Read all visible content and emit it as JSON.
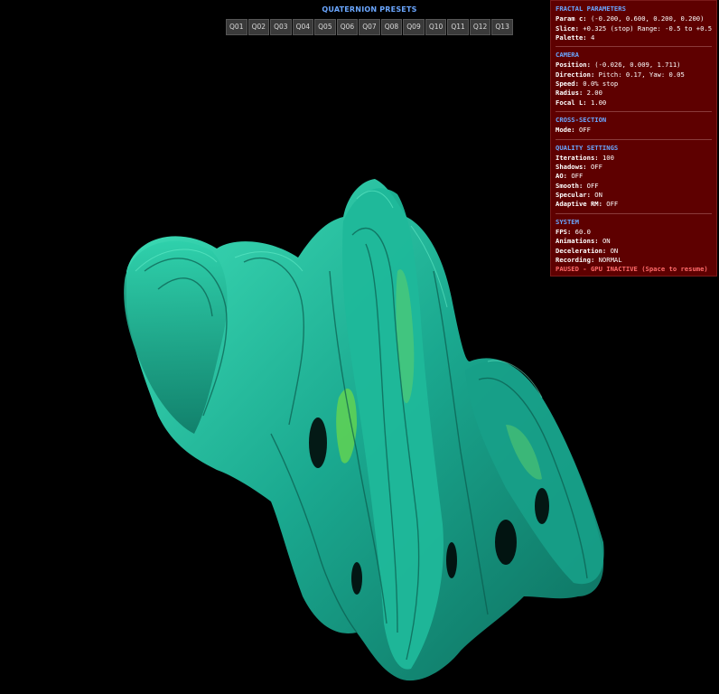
{
  "presets": {
    "title": "QUATERNION PRESETS",
    "buttons": [
      "Q01",
      "Q02",
      "Q03",
      "Q04",
      "Q05",
      "Q06",
      "Q07",
      "Q08",
      "Q09",
      "Q10",
      "Q11",
      "Q12",
      "Q13"
    ]
  },
  "panel": {
    "fractal": {
      "title": "FRACTAL PARAMETERS",
      "param_c_label": "Param c:",
      "param_c_value": "(-0.200, 0.600, 0.200, 0.200)",
      "slice_label": "Slice:",
      "slice_value": "+0.325 (stop) Range: -0.5 to +0.5",
      "palette_label": "Palette:",
      "palette_value": "4"
    },
    "camera": {
      "title": "CAMERA",
      "position_label": "Position:",
      "position_value": "(-0.026, 0.009, 1.711)",
      "direction_label": "Direction:",
      "direction_value": "Pitch: 0.17, Yaw: 0.05",
      "speed_label": "Speed:",
      "speed_value": "0.0% stop",
      "radius_label": "Radius:",
      "radius_value": "2.00",
      "focal_label": "Focal L:",
      "focal_value": "1.00"
    },
    "cross_section": {
      "title": "CROSS-SECTION",
      "mode_label": "Mode:",
      "mode_value": "OFF"
    },
    "quality": {
      "title": "QUALITY SETTINGS",
      "iterations_label": "Iterations:",
      "iterations_value": "100",
      "shadows_label": "Shadows:",
      "shadows_value": "OFF",
      "ao_label": "AO:",
      "ao_value": "OFF",
      "smooth_label": "Smooth:",
      "smooth_value": "OFF",
      "specular_label": "Specular:",
      "specular_value": "ON",
      "adaptive_label": "Adaptive RM:",
      "adaptive_value": "OFF"
    },
    "system": {
      "title": "SYSTEM",
      "fps_label": "FPS:",
      "fps_value": "60.0",
      "animations_label": "Animations:",
      "animations_value": "ON",
      "deceleration_label": "Deceleration:",
      "deceleration_value": "ON",
      "recording_label": "Recording:",
      "recording_value": "NORMAL",
      "status_text": "PAUSED - GPU INACTIVE (Space to resume)"
    }
  },
  "colors": {
    "background": "#000000",
    "fractal_primary": "#1aa88f",
    "fractal_highlight": "#3fe0b8",
    "fractal_inner": "#6bd84a",
    "panel_bg": "#5e0000",
    "section_title": "#6aa6ff",
    "warning": "#ff6a6a"
  }
}
